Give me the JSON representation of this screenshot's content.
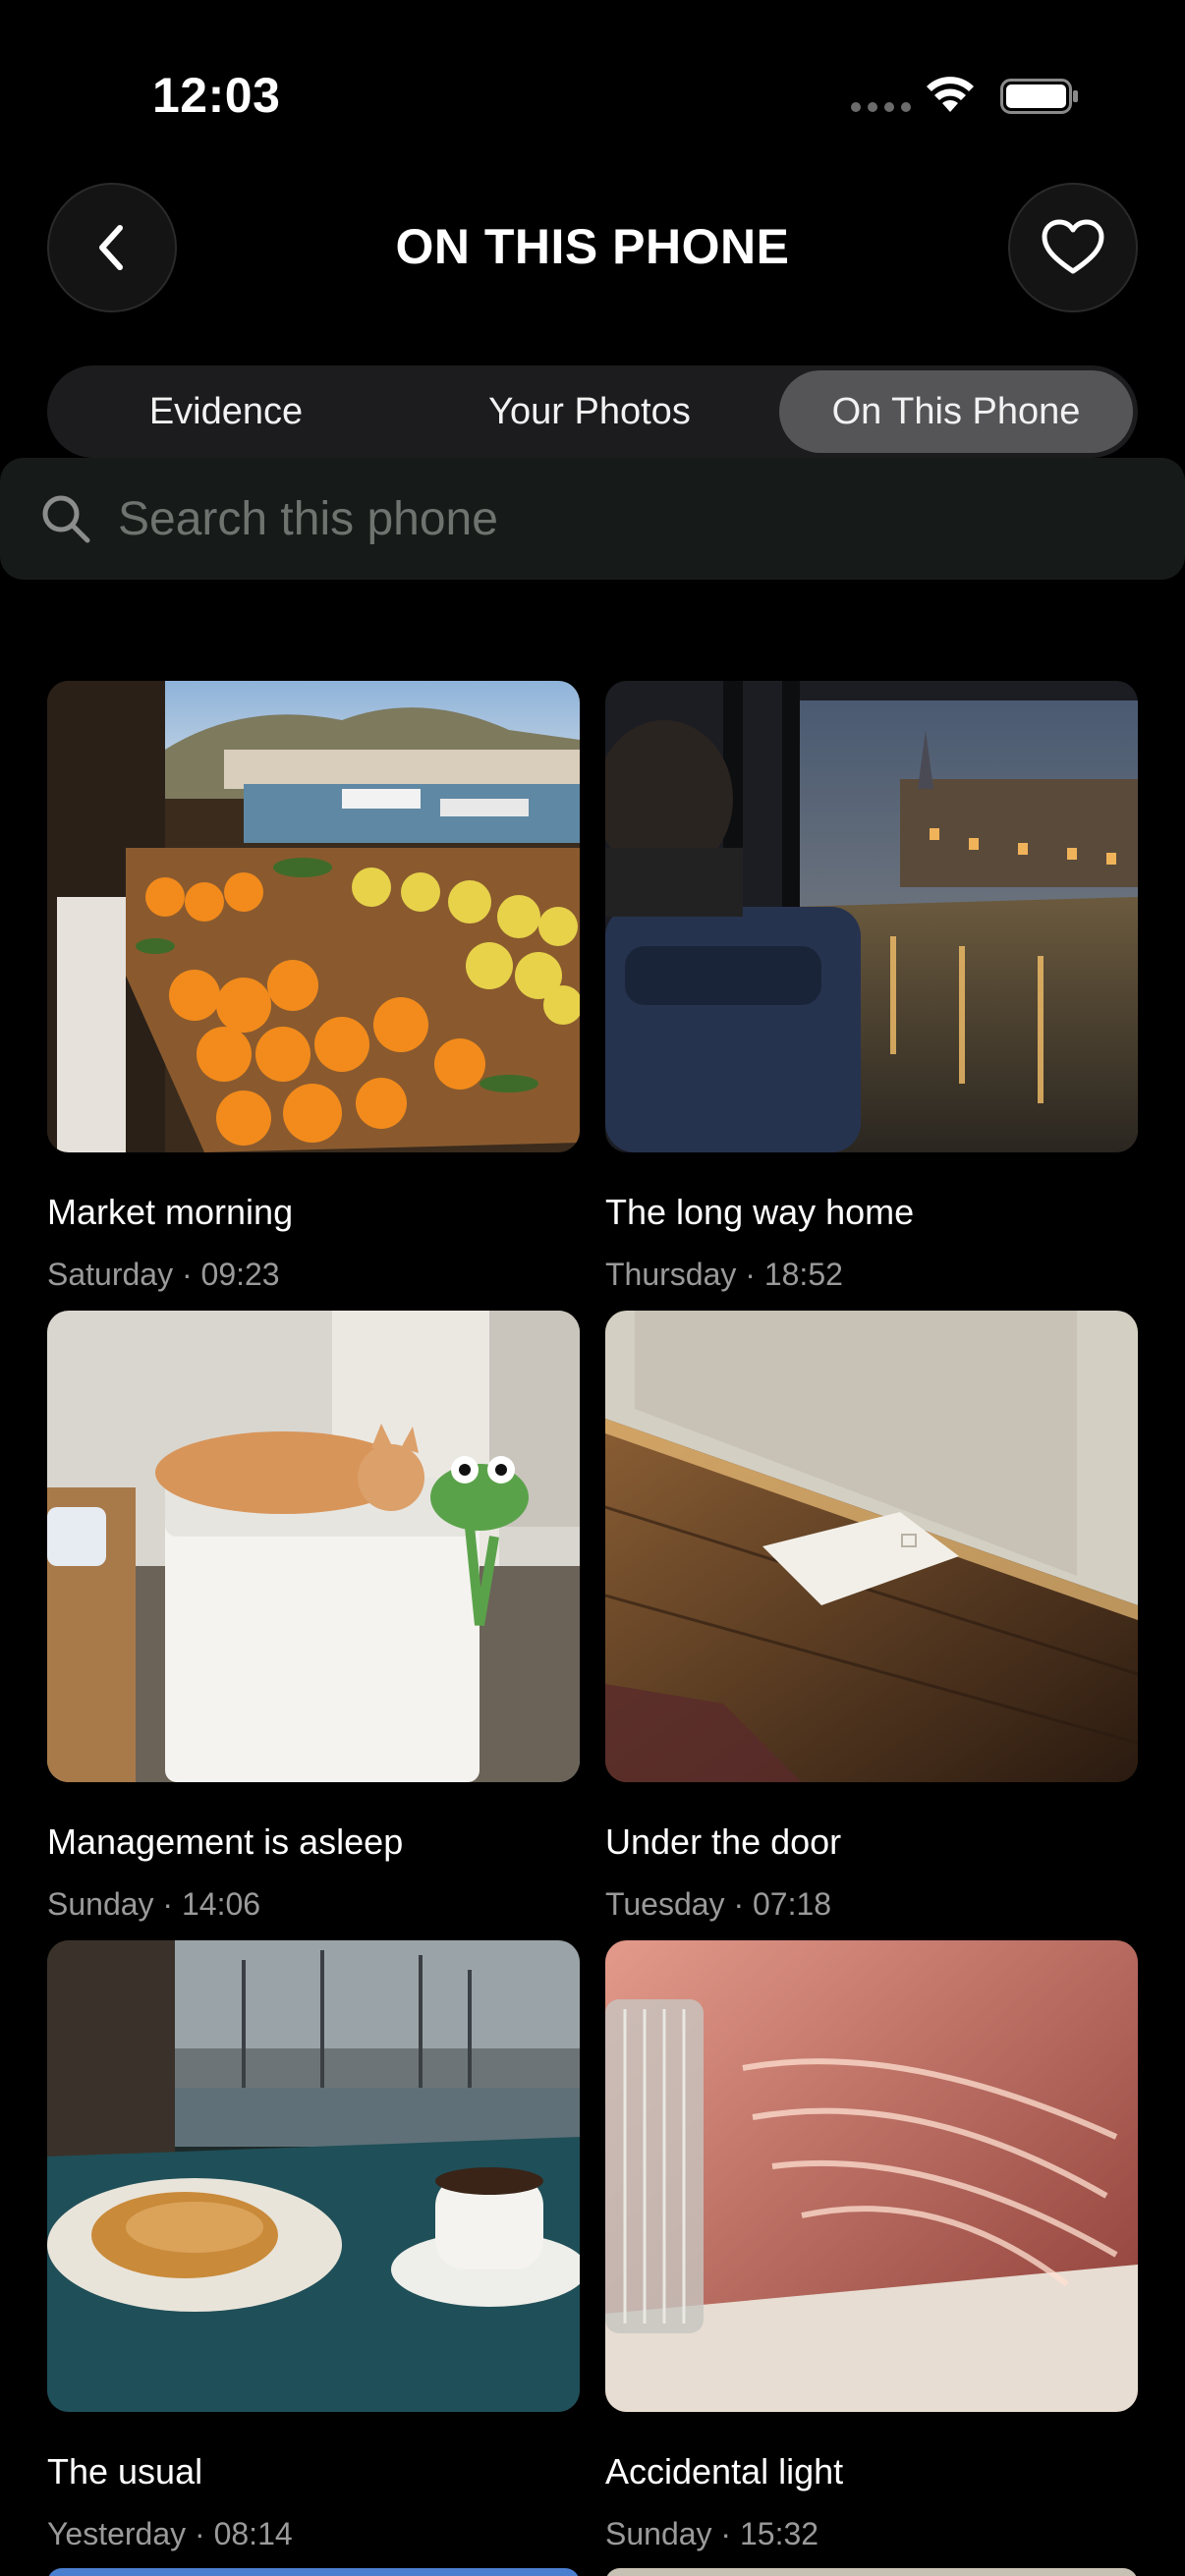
{
  "status": {
    "time": "12:03"
  },
  "header": {
    "title": "ON THIS PHONE"
  },
  "tabs": [
    {
      "label": "Evidence"
    },
    {
      "label": "Your Photos"
    },
    {
      "label": "On This Phone",
      "selected": true
    }
  ],
  "search": {
    "placeholder": "Search this phone",
    "value": ""
  },
  "photos": [
    {
      "title": "Market morning",
      "meta": "Saturday · 09:23"
    },
    {
      "title": "The long way home",
      "meta": "Thursday · 18:52"
    },
    {
      "title": "Management is asleep",
      "meta": "Sunday · 14:06"
    },
    {
      "title": "Under the door",
      "meta": "Tuesday · 07:18"
    },
    {
      "title": "The usual",
      "meta": "Yesterday · 08:14"
    },
    {
      "title": "Accidental light",
      "meta": "Sunday · 15:32"
    }
  ],
  "colors": {
    "accent_selected_tab": "#555558",
    "background": "#000000",
    "meta_text": "#9a9a9a"
  },
  "icons": [
    "back-chevron-icon",
    "heart-icon",
    "search-icon",
    "wifi-icon",
    "battery-icon"
  ]
}
